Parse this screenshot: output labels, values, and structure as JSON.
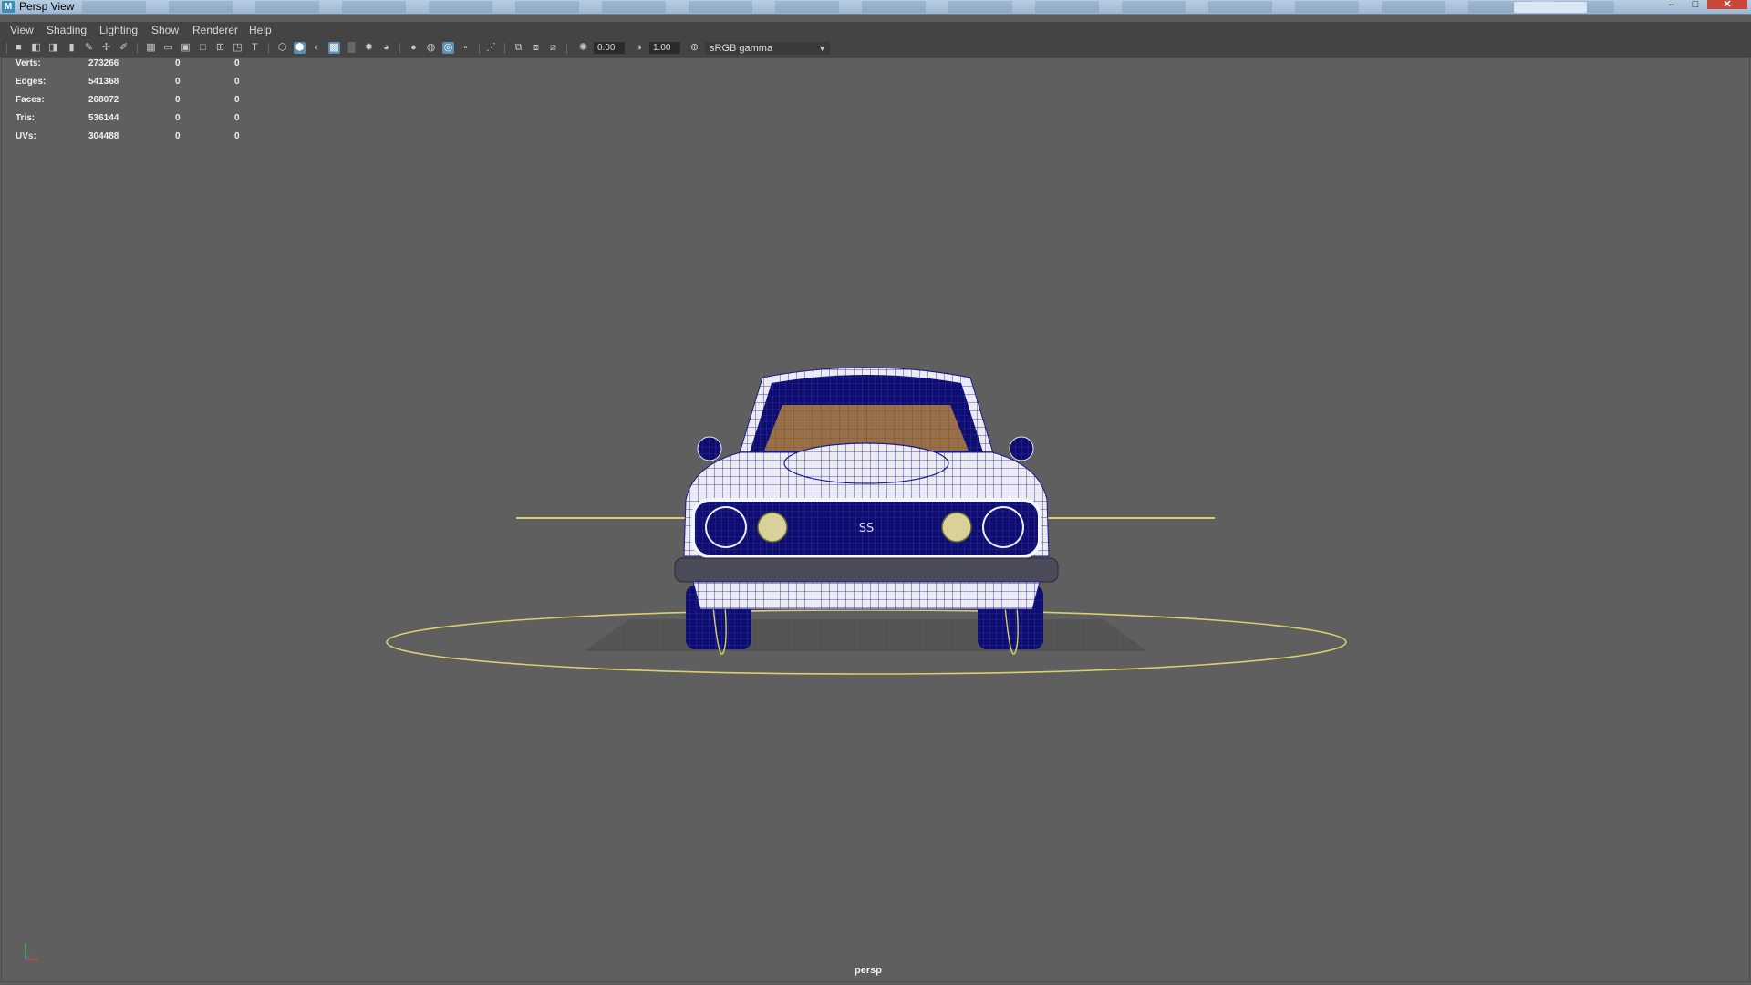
{
  "window": {
    "title": "Persp View",
    "app_icon": "M"
  },
  "menubar": {
    "items": [
      "View",
      "Shading",
      "Lighting",
      "Show",
      "Renderer",
      "Help"
    ]
  },
  "toolbar": {
    "exposure_value": "0.00",
    "gamma_value": "1.00",
    "color_space": "sRGB gamma"
  },
  "hud": {
    "rows": [
      {
        "label": "Verts:",
        "values": [
          "273266",
          "0",
          "0"
        ]
      },
      {
        "label": "Edges:",
        "values": [
          "541368",
          "0",
          "0"
        ]
      },
      {
        "label": "Faces:",
        "values": [
          "268072",
          "0",
          "0"
        ]
      },
      {
        "label": "Tris:",
        "values": [
          "536144",
          "0",
          "0"
        ]
      },
      {
        "label": "UVs:",
        "values": [
          "304488",
          "0",
          "0"
        ]
      }
    ]
  },
  "viewport": {
    "camera_name": "persp"
  },
  "colors": {
    "viewport_bg": "#5f5f5f",
    "wireframe": "#1a1a8c",
    "selection_curve": "#d8d06a",
    "interior": "#b08040"
  }
}
